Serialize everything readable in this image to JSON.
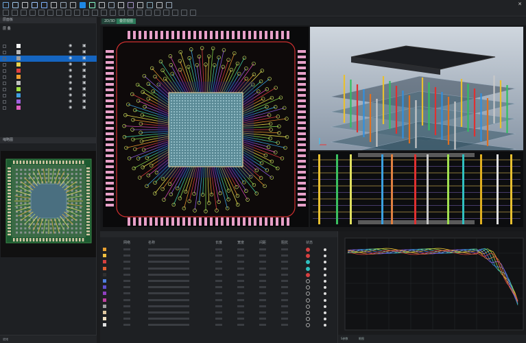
{
  "toolbar": {
    "icons": [
      "file-icon",
      "open-icon",
      "save-icon",
      "export-icon",
      "undo-icon",
      "redo-icon",
      "zoom-in-icon",
      "zoom-out-icon",
      "select-icon",
      "route-icon",
      "via-icon",
      "measure-icon",
      "layer-icon",
      "net-icon",
      "drc-icon",
      "3d-icon",
      "settings-icon",
      "help-icon"
    ]
  },
  "left_panel": {
    "layers_title": "层面板",
    "tree_root": "层 叠",
    "layers": [
      {
        "color": "#f4f4f4"
      },
      {
        "color": "#b8b8b8"
      },
      {
        "color": "#9e9e9e"
      },
      {
        "color": "#e8d24c"
      },
      {
        "color": "#e04040"
      },
      {
        "color": "#f0a030"
      },
      {
        "color": "#c0c0c0"
      },
      {
        "color": "#a0e040"
      },
      {
        "color": "#40a0e0"
      },
      {
        "color": "#a060e0"
      },
      {
        "color": "#e060c0"
      }
    ],
    "preview_title": "缩略图"
  },
  "main": {
    "tabs": [
      "2D/3D",
      "叠层视图"
    ],
    "table_headers": [
      "",
      "网络",
      "名称",
      "长度",
      "宽度",
      "间距",
      "阻抗",
      "状态",
      ""
    ],
    "rows": [
      {
        "color": "#e8a030",
        "status": "#d84040"
      },
      {
        "color": "#f0c040",
        "status": "#d84040"
      },
      {
        "color": "#d84040",
        "status": "#30c0c0"
      },
      {
        "color": "#e06030",
        "status": "#30c0c0"
      },
      {
        "color": "#303030",
        "status": "#d84040"
      },
      {
        "color": "#5080e0",
        "status": ""
      },
      {
        "color": "#6050d0",
        "status": ""
      },
      {
        "color": "#9040c0",
        "status": ""
      },
      {
        "color": "#c040a0",
        "status": ""
      },
      {
        "color": "#a0a0a0",
        "status": ""
      },
      {
        "color": "#e0c8a0",
        "status": ""
      },
      {
        "color": "#f0e0c0",
        "status": ""
      },
      {
        "color": "#e0e0e0",
        "status": ""
      }
    ],
    "bottom_tabs": [
      "S参数",
      "眼图"
    ],
    "status_left": "就绪"
  }
}
